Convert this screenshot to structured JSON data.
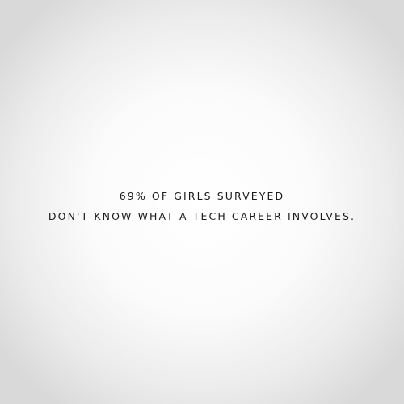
{
  "headline": {
    "line1": "69% OF GIRLS SURVEYED",
    "line2": "DON'T KNOW WHAT A TECH CAREER INVOLVES."
  },
  "colors": {
    "text": "#1a1a1a",
    "background_center": "#ffffff",
    "background_edge": "#d9d9d9"
  }
}
